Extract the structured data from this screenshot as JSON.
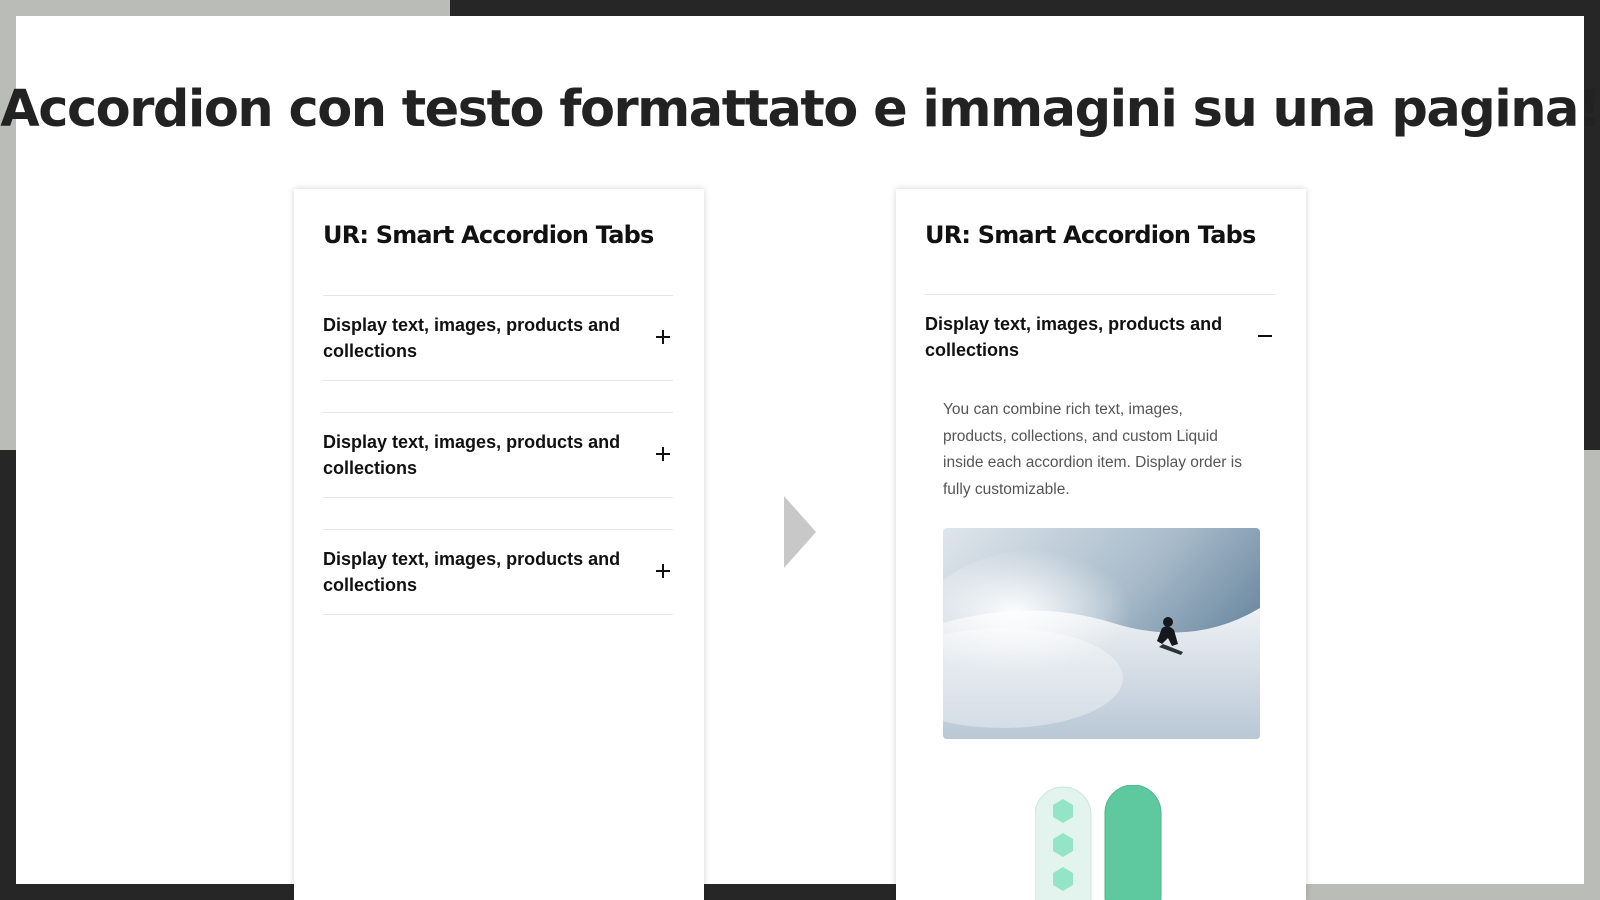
{
  "headline": "Accordion con testo formattato e immagini su una pagina!",
  "colors": {
    "background_dark": "#262626",
    "background_grey": "#babcb7",
    "canvas": "#ffffff",
    "headline": "#222222",
    "arrow": "#c8c8c8"
  },
  "before_preview": {
    "title": "UR: Smart Accordion Tabs",
    "items": [
      {
        "label": "Display text, images, products and collections",
        "icon": "plus-icon",
        "expanded": false
      },
      {
        "label": "Display text, images, products and collections",
        "icon": "plus-icon",
        "expanded": false
      },
      {
        "label": "Display text, images, products and collections",
        "icon": "plus-icon",
        "expanded": false
      }
    ]
  },
  "arrow_icon": "chevron-right-icon",
  "after_preview": {
    "title": "UR: Smart Accordion Tabs",
    "items": [
      {
        "label": "Display text, images, products and collections",
        "icon": "minus-icon",
        "expanded": true,
        "body_text": "You can combine rich text, images, products, collections, and custom Liquid inside each accordion item. Display order is fully customizable.",
        "images": [
          "snowboarder-photo",
          "snowboards-product-image"
        ]
      }
    ]
  }
}
